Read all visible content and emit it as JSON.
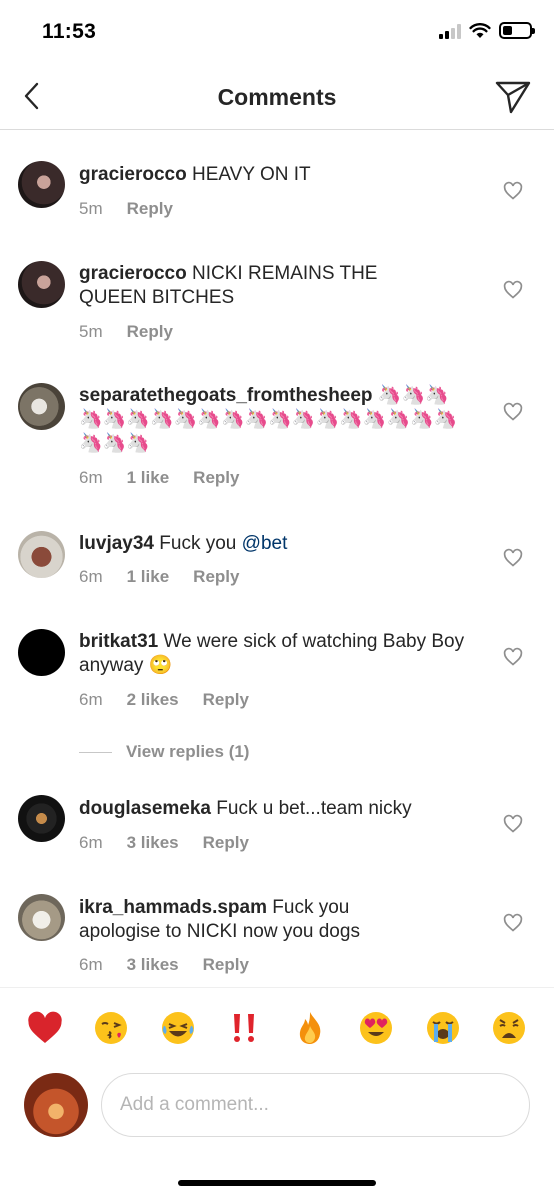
{
  "status_bar": {
    "time": "11:53"
  },
  "header": {
    "title": "Comments",
    "back_icon": "chevron-left-icon",
    "share_icon": "send-icon"
  },
  "comments": [
    {
      "username": "gracierocco",
      "text": "HEAVY ON IT",
      "time": "5m",
      "likes": "",
      "reply": "Reply"
    },
    {
      "username": "gracierocco",
      "text": "NICKI REMAINS THE QUEEN BITCHES",
      "time": "5m",
      "likes": "",
      "reply": "Reply"
    },
    {
      "username": "separatethegoats_fromthesheep",
      "text": "🦄🦄🦄🦄🦄🦄🦄🦄🦄🦄🦄🦄🦄🦄🦄🦄🦄🦄🦄🦄🦄🦄",
      "time": "6m",
      "likes": "1 like",
      "reply": "Reply"
    },
    {
      "username": "luvjay34",
      "text": "Fuck you ",
      "mention": "@bet",
      "time": "6m",
      "likes": "1 like",
      "reply": "Reply"
    },
    {
      "username": "britkat31",
      "text": "We were sick of watching Baby Boy anyway 🙄",
      "time": "6m",
      "likes": "2 likes",
      "reply": "Reply"
    },
    {
      "username": "douglasemeka",
      "text": "Fuck u bet...team nicky",
      "time": "6m",
      "likes": "3 likes",
      "reply": "Reply"
    },
    {
      "username": "ikra_hammads.spam",
      "text": "Fuck you apologise to NICKI now you dogs",
      "time": "6m",
      "likes": "3 likes",
      "reply": "Reply"
    }
  ],
  "view_replies": "View replies (1)",
  "quick_emojis": [
    "❤️",
    "😘",
    "😂",
    "‼️",
    "🔥",
    "😍",
    "😭",
    "😩"
  ],
  "comment_input": {
    "placeholder": "Add a comment..."
  },
  "colors": {
    "text": "#262626",
    "muted": "#8e8e8e",
    "border": "#dbdbdb",
    "mention": "#003569"
  }
}
